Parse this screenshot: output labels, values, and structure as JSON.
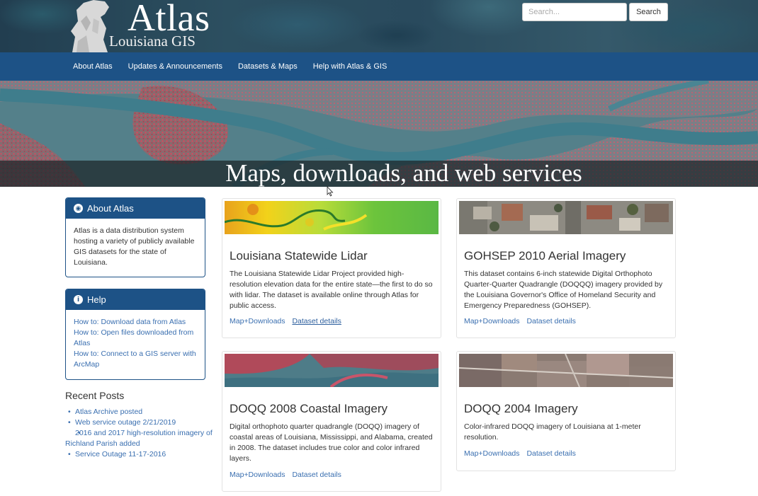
{
  "header": {
    "logo_title": "Atlas",
    "logo_subtitle": "Louisiana GIS",
    "search_placeholder": "Search...",
    "search_button": "Search"
  },
  "nav": {
    "items": [
      "About Atlas",
      "Updates & Announcements",
      "Datasets & Maps",
      "Help with Atlas & GIS"
    ]
  },
  "hero": {
    "title": "Maps, downloads, and web services"
  },
  "sidebar": {
    "about": {
      "title": "About Atlas",
      "icon": "globe-icon",
      "body": "Atlas is a data distribution system hosting a variety of publicly available GIS datasets for the state of Louisiana."
    },
    "help": {
      "title": "Help",
      "icon": "info-icon",
      "links": [
        "How to: Download data from Atlas",
        "How to: Open files downloaded from Atlas",
        "How to: Connect to a GIS server with ArcMap"
      ]
    },
    "recent": {
      "title": "Recent Posts",
      "items": [
        "Atlas Archive posted",
        "Web service outage 2/21/2019",
        "2016 and 2017 high-resolution imagery of Richland Parish added",
        "Service Outage 11-17-2016"
      ]
    }
  },
  "cards": [
    {
      "title": "Louisiana Statewide Lidar",
      "desc": "The Louisiana Statewide Lidar Project provided high-resolution elevation data for the entire state—the first to do so with lidar. The dataset is available online through Atlas for public access.",
      "link1": "Map+Downloads",
      "link2": "Dataset details"
    },
    {
      "title": "GOHSEP 2010 Aerial Imagery",
      "desc": "This dataset contains 6-inch statewide Digital Orthophoto Quarter-Quarter Quadrangle (DOQQQ) imagery provided by the Louisiana Governor's Office of Homeland Security and Emergency Preparedness (GOHSEP).",
      "link1": "Map+Downloads",
      "link2": "Dataset details"
    },
    {
      "title": "DOQQ 2008 Coastal Imagery",
      "desc": "Digital orthophoto quarter quadrangle (DOQQ) imagery of coastal areas of Louisiana, Mississippi, and Alabama, created in 2008. The dataset includes true color and color infrared layers.",
      "link1": "Map+Downloads",
      "link2": "Dataset details"
    },
    {
      "title": "DOQQ 2004 Imagery",
      "desc": "Color-infrared DOQQ imagery of Louisiana at 1-meter resolution.",
      "link1": "Map+Downloads",
      "link2": "Dataset details"
    }
  ],
  "colors": {
    "nav_blue": "#1d5286",
    "link_blue": "#3a6fb0",
    "infrared_red": "#d9485e"
  }
}
